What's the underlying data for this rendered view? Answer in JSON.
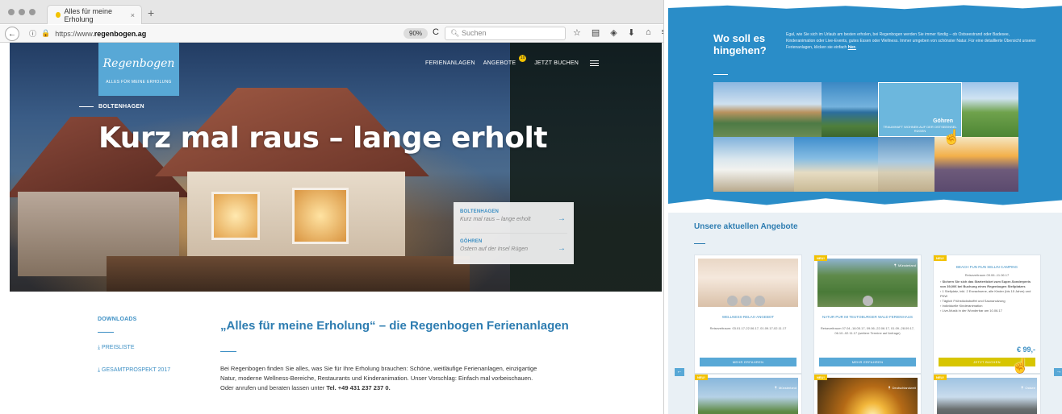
{
  "browser": {
    "tab_title": "Alles für meine Erholung",
    "tab_close": "×",
    "new_tab": "+",
    "url_prefix": "https://www.",
    "url_domain": "regenbogen.ag",
    "zoom": "90%",
    "search_placeholder": "Suchen",
    "toolbar_icons": [
      "☆",
      "▤",
      "◈",
      "⬇",
      "⌂",
      "≡"
    ]
  },
  "hero": {
    "logo_script": "Regenbogen",
    "logo_tagline": "ALLES FÜR MEINE ERHOLUNG",
    "nav": [
      "FERIENANLAGEN",
      "ANGEBOTE",
      "JETZT BUCHEN"
    ],
    "nav_badge": "10",
    "kicker": "BOLTENHAGEN",
    "headline": "Kurz mal raus – lange erholt",
    "slides": [
      {
        "title": "BOLTENHAGEN",
        "subtitle": "Kurz mal raus – lange erholt"
      },
      {
        "title": "GÖHREN",
        "subtitle": "Ostern auf der Insel Rügen"
      }
    ]
  },
  "downloads": {
    "heading": "DOWNLOADS",
    "links": [
      "⤓ PREISLISTE",
      "⤓ GESAMTPROSPEKT 2017"
    ]
  },
  "intro": {
    "title": "„Alles für meine Erholung“ – die Regenbogen Ferienanlagen",
    "text": "Bei Regenbogen finden Sie alles, was Sie für Ihre Erholung brauchen: Schöne, weitläufige Ferienanlagen, einzigartige Natur, moderne Wellness-Bereiche, Restaurants und Kinderanimation. Unser Vorschlag: Einfach mal vorbeischauen. Oder anrufen und beraten lassen unter",
    "phone": "Tel. +49 431 237 237 0."
  },
  "destinations": {
    "title": "Wo soll es hingehen?",
    "text": "Egal, wie Sie sich im Urlaub am besten erholen, bei Regenbogen werden Sie immer fündig – ob Ostseestrand oder Badesee, Kinderanimation oder Live-Events, gutes Essen oder Wellness. Immer umgeben von schönster Natur. Für eine detaillierte Übersicht unserer Ferienanlagen, klicken sie einfach",
    "link": "hier.",
    "hover_name": "Göhren",
    "hover_caption": "TRAUMHAFT WOHNEN AUF DER OSTSEEINSEL RÜGEN"
  },
  "offers": {
    "title": "Unsere aktuellen Angebote",
    "cards": [
      {
        "title": "WELLNESS-RELAX-ANGEBOT",
        "detail": "Reisezeitraum: 03.01.17-22.06.17, 01.09.17-02.11.17",
        "button": "MEHR ERFAHREN"
      },
      {
        "badge": "NEU!",
        "location": "Münsterland",
        "title": "NATUR PUR IM TEUTOBURGER WALD FERIENHAUS",
        "detail": "Reisezeitraum 07.04.-18.05.17, 09.06.-22.06.17, 01.09.-28.09.17, 06.10.-02.11.17 (weitere Termine auf Anfrage)",
        "button": "MEHR ERFAHREN"
      },
      {
        "badge": "NEU!",
        "title": "BEACH FUN RUN SELLIN CAMPING",
        "detail": "Reisezeitraum 09.06.-11.06.17",
        "bullets": [
          "Sichern Sie sich das Starterticket zum Super-Sonderpreis von 39,00€ bei Buchung eines Regenbogen Stellplatzes",
          "1 Stellplatz, inkl. 2 Erwachsene, alle Kinder (bis 15 Jahre) und PKW",
          "Täglich Frühstücksbuffet und Saunanutzung",
          "Individuelle Kinderanimation",
          "Live-Musik in der Wonderbar am 10.06.17"
        ],
        "price": "€ 99,-",
        "button": "JETZT BUCHEN"
      }
    ],
    "bottom_cards": [
      {
        "badge": "NEU!",
        "location": "Münsterland"
      },
      {
        "badge": "NEU!",
        "location": "Deutschlandweit"
      },
      {
        "badge": "NEU!",
        "location": "Ostsee"
      }
    ],
    "arrow_left": "←",
    "arrow_right": "→"
  }
}
